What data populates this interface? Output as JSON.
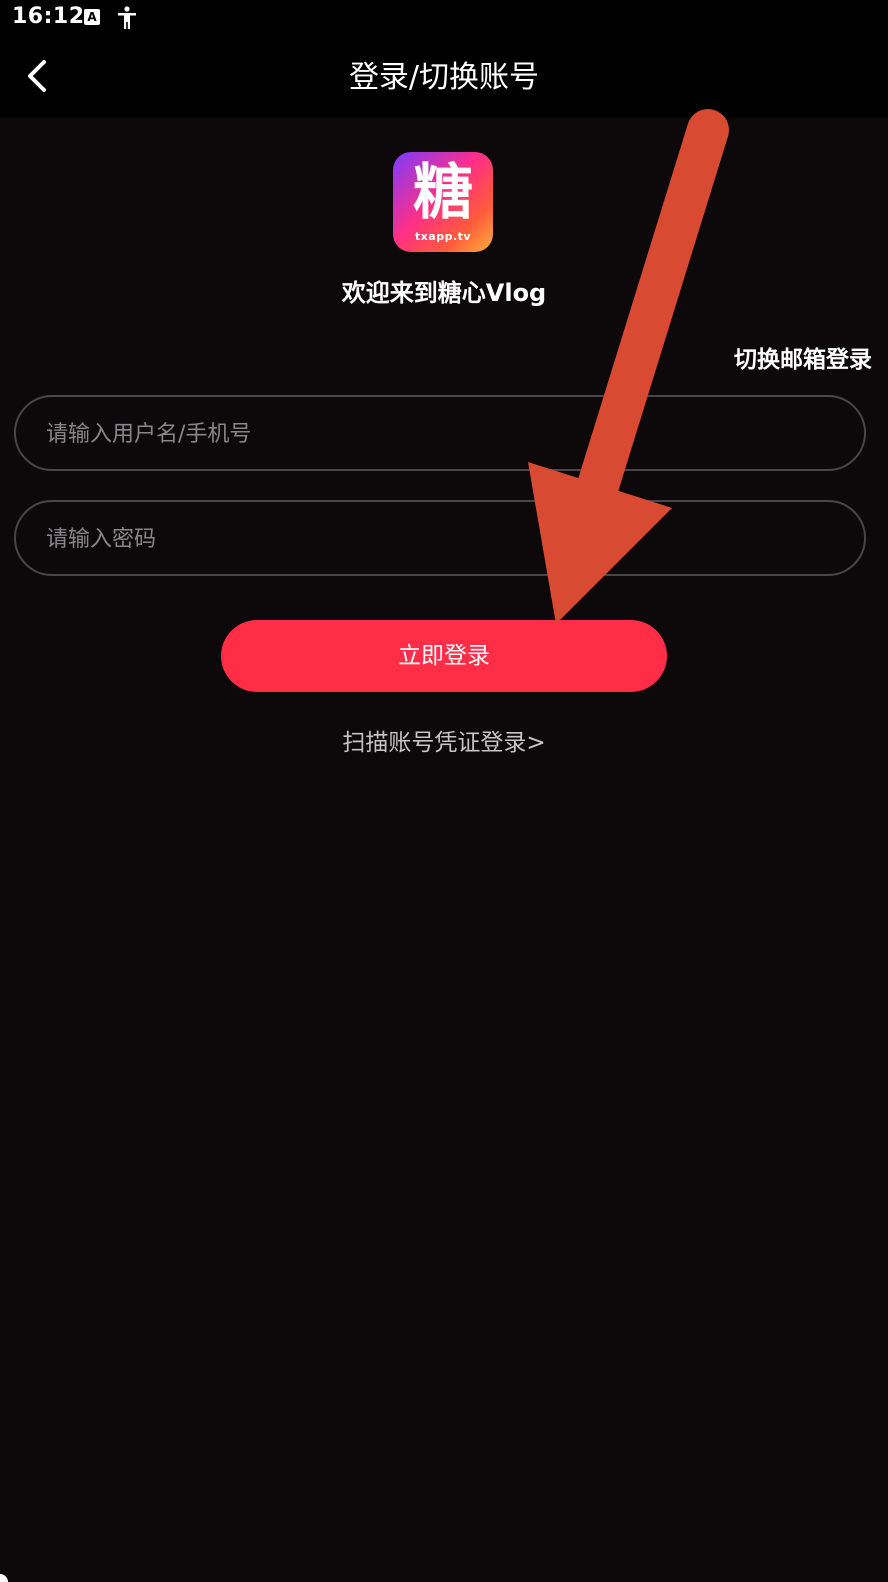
{
  "status_bar": {
    "time": "16:12",
    "icons": [
      "keyboard-a-icon",
      "accessibility-icon"
    ]
  },
  "nav": {
    "title": "登录/切换账号",
    "back_icon": "chevron-left-icon"
  },
  "app": {
    "logo_char": "糖",
    "logo_sub": "txapp.tv",
    "welcome": "欢迎来到糖心Vlog"
  },
  "login": {
    "switch_email": "切换邮箱登录",
    "username_placeholder": "请输入用户名/手机号",
    "password_placeholder": "请输入密码",
    "submit_label": "立即登录",
    "scan_label": "扫描账号凭证登录>"
  },
  "colors": {
    "background": "#0d080a",
    "accent": "#ff2d45",
    "annotation_arrow": "#d94a33"
  }
}
